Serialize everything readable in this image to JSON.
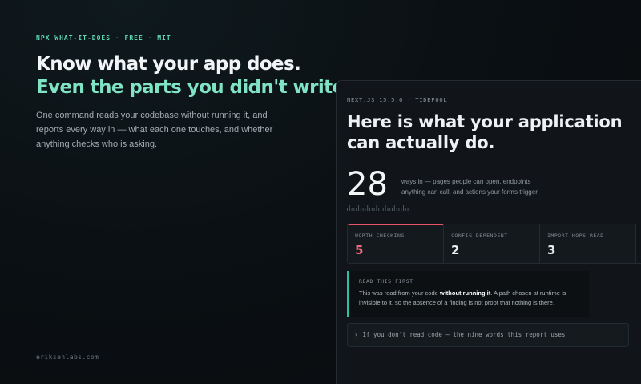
{
  "hero": {
    "eyebrow": "NPX WHAT-IT-DOES · FREE · MIT",
    "title_line1": "Know what your app does.",
    "title_line2": "Even the parts you didn't write.",
    "subtitle": "One command reads your codebase without running it, and reports every way in — what each one touches, and whether anything checks who is asking."
  },
  "footer": {
    "link": "eriksenlabs.com"
  },
  "panel": {
    "eyebrow": "NEXT.JS 15.5.0 · TIDEPOOL",
    "title": "Here is what your application can actually do.",
    "count": "28",
    "count_description": "ways in — pages people can open, endpoints anything can call, and actions your forms trigger.",
    "stats": [
      {
        "label": "WORTH CHECKING",
        "value": "5"
      },
      {
        "label": "CONFIG-DEPENDENT",
        "value": "2"
      },
      {
        "label": "IMPORT HOPS READ",
        "value": "3"
      }
    ],
    "note": {
      "label": "READ THIS FIRST",
      "text_before": "This was read from your code ",
      "text_bold": "without running it",
      "text_after": ". A path chosen at runtime is invisible to it, so the absence of a finding is not proof that nothing is there."
    },
    "disclosure": {
      "chevron": "›",
      "label": "If you don't read code — the nine words this report uses"
    }
  },
  "colors": {
    "accent": "#7fe3c4",
    "alert": "#ef6a7c",
    "note_border": "#2fc1a6"
  }
}
